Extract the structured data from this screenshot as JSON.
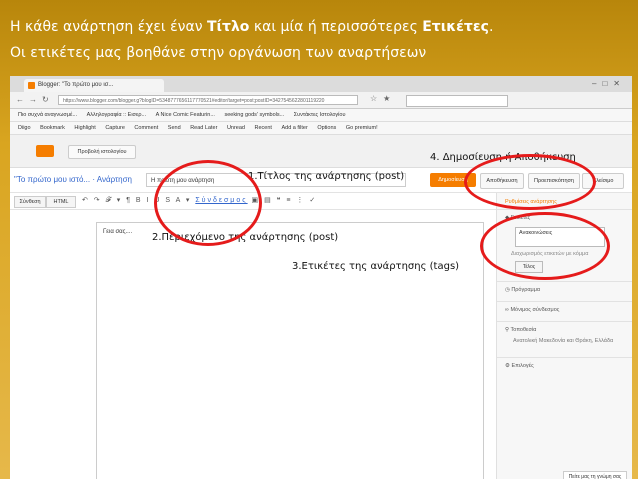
{
  "heading": {
    "line1_pre": "Η κάθε ανάρτηση έχει έναν ",
    "line1_title": "Τίτλο",
    "line1_mid": " και μία ή περισσότερες ",
    "line1_labels": "Ετικέτες",
    "line1_end": ".",
    "line2": "Οι ετικέτες μας βοηθάνε στην οργάνωση των αναρτήσεων"
  },
  "browser": {
    "tab_title": "Blogger: \"Το πρώτο μου ισ...",
    "url": "https://www.blogger.com/blogger.g?blogID=5348777656117770521#editor/target=post;postID=3427545622801119220",
    "bookmarks": [
      "Πιο συχνά αναγνωσμέ...",
      "Αλληλογραφία :: Εισερ...",
      "A Nice Comic Featurin...",
      "seeking gods' symbols...",
      "Συντάκτες Ιστολογίου"
    ],
    "toolbar": [
      "Diigo",
      "Bookmark",
      "Highlight",
      "Capture",
      "Comment",
      "Send",
      "Read Later",
      "Unread",
      "Recent",
      "Add a filter",
      "Options",
      "Go premium!"
    ]
  },
  "blogger": {
    "view_blog": "Προβολή ιστολογίου",
    "blog_name": "\"Το πρώτο μου ιστό... · Ανάρτηση",
    "title_value": "Η πρώτη μου ανάρτηση",
    "publish": "Δημοσίευση",
    "save": "Αποθήκευση",
    "preview": "Προεπισκόπηση",
    "close": "Κλείσιμο",
    "compose": "Σύνθεση",
    "html": "HTML",
    "toolbar_link": "Σύνδεσμος",
    "editor_text": "Γεια σας....",
    "settings_header": "Ρυθμίσεις ανάρτησης",
    "labels_title": "Ετικέτες",
    "labels_value": "Ανακοινώσεις",
    "labels_hint": "Διαχωρισμός ετικετών με κόμμα",
    "done": "Τέλος",
    "schedule": "Πρόγραμμα",
    "permalink": "Μόνιμος σύνδεσμος",
    "location": "Τοποθεσία",
    "location_value": "Ανατολική Μακεδονία και Θράκη, Ελλάδα",
    "options": "Επιλογές",
    "help": "Πείτε μας τη γνώμη σας"
  },
  "annotations": {
    "a1": "1.Τίτλος της ανάρτησης (post)",
    "a2": "2.Περιεχόμενο της ανάρτησης (post)",
    "a3": "3.Ετικέτες της ανάρτησης (tags)",
    "a4": "4. Δημοσίευση ή Αποθήκευση"
  },
  "colors": {
    "accent": "#f57d00",
    "circle": "#e51b1b",
    "background": "#d9a520"
  }
}
